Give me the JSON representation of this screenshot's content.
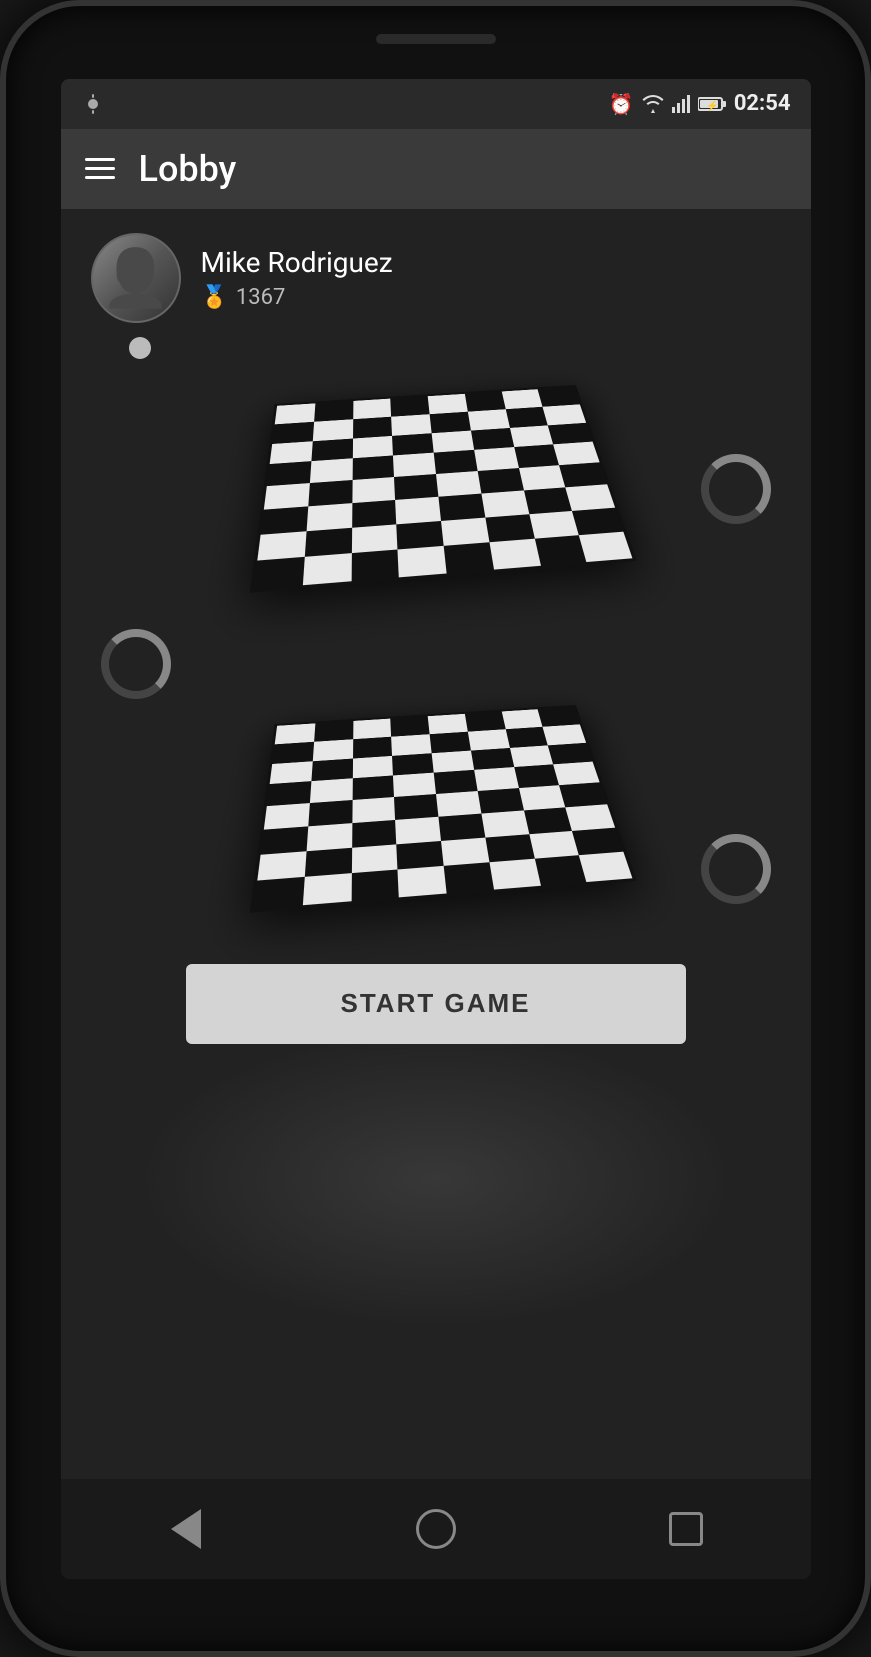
{
  "phone": {
    "status_bar": {
      "time": "02:54",
      "icons": [
        "alarm",
        "wifi",
        "signal",
        "battery"
      ]
    },
    "toolbar": {
      "title": "Lobby",
      "menu_label": "Menu"
    },
    "user": {
      "name": "Mike Rodriguez",
      "rating": "1367",
      "online": true
    },
    "boards": [
      {
        "id": 1
      },
      {
        "id": 2
      }
    ],
    "start_button": {
      "label": "START GAME"
    },
    "nav": {
      "back_label": "Back",
      "home_label": "Home",
      "recent_label": "Recent"
    }
  }
}
